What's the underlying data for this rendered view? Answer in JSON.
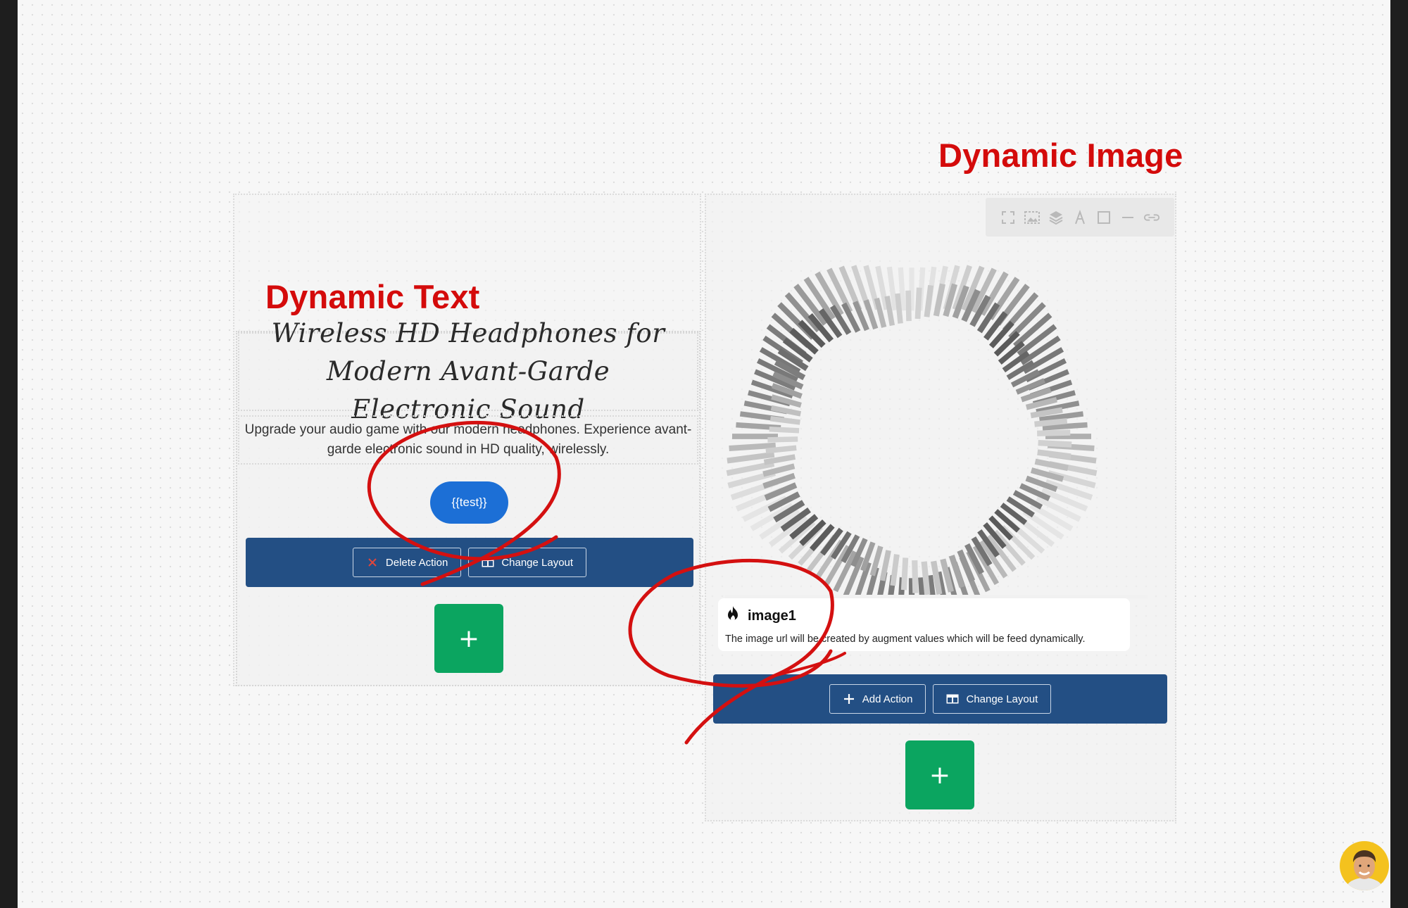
{
  "annotations": {
    "dynamic_text": "Dynamic Text",
    "dynamic_image": "Dynamic Image"
  },
  "left_section": {
    "heading": "Wireless HD Headphones for Modern Avant-Garde Electronic Sound",
    "description": "Upgrade your audio game with our modern headphones. Experience avant-garde electronic sound in HD quality, wirelessly.",
    "template_button": "{{test}}",
    "action_bar": {
      "delete_label": "Delete Action",
      "change_layout_label": "Change Layout"
    },
    "add_label": "+"
  },
  "right_section": {
    "toolbar_icons": [
      "expand-icon",
      "image-select-icon",
      "layers-icon",
      "text-style-icon",
      "square-icon",
      "minus-icon",
      "link-icon"
    ],
    "caption": {
      "title": "image1",
      "description": "The image url will be created by augment values which will be feed dynamically."
    },
    "action_bar": {
      "add_label": "Add Action",
      "change_layout_label": "Change Layout"
    },
    "add_label": "+"
  },
  "colors": {
    "annotation": "#d40b0b",
    "action_bar": "#234f84",
    "add_button": "#0ba560",
    "pill_button": "#1c6fd6"
  }
}
